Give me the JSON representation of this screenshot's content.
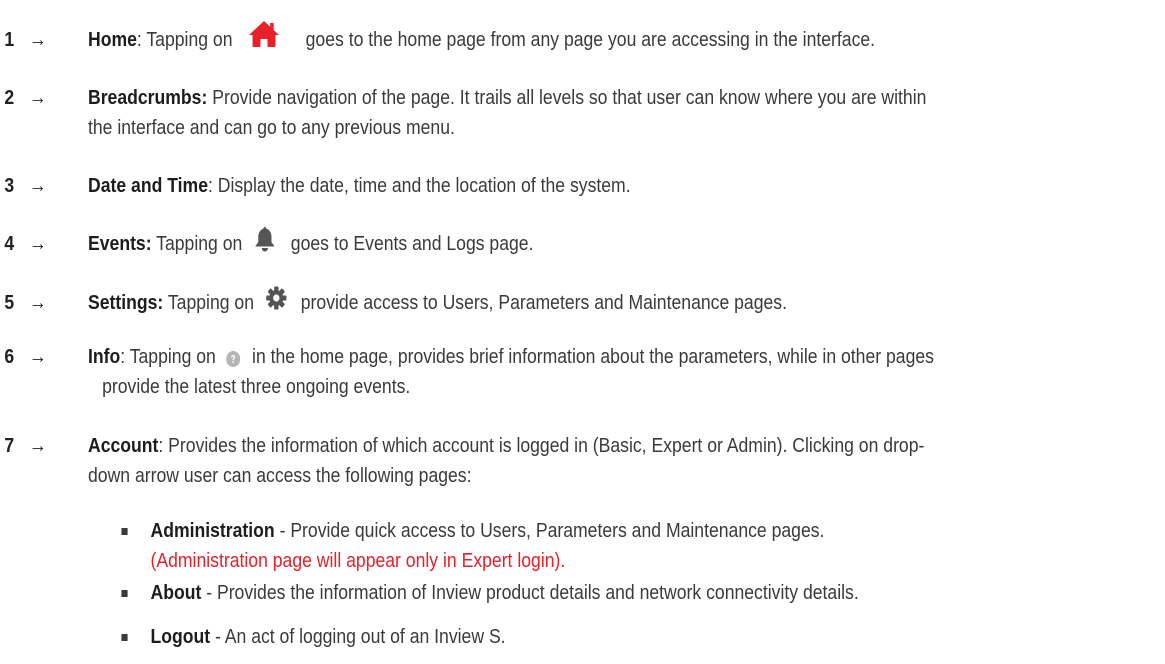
{
  "items": [
    {
      "num": "1",
      "arrow": "→",
      "term": "Home",
      "sep": ": Tapping on",
      "icon": "home-icon",
      "rest": "goes to the home page from any page you are accessing in the interface."
    },
    {
      "num": "2",
      "arrow": "→",
      "term": "Breadcrumbs:",
      "rest": "Provide navigation of the page. It trails all levels so that user can know where you are within",
      "rest2": "the interface and can go to any previous menu."
    },
    {
      "num": "3",
      "arrow": "→",
      "term": "Date and Time",
      "rest": ": Display the date, time and the location of the system."
    },
    {
      "num": "4",
      "arrow": "→",
      "term": "Events:",
      "sep": "Tapping on",
      "icon": "bell-icon",
      "rest": "goes to Events and Logs page."
    },
    {
      "num": "5",
      "arrow": "→",
      "term": "Settings:",
      "sep": "Tapping on",
      "icon": "gear-icon",
      "rest": "provide access to Users, Parameters and Maintenance pages."
    },
    {
      "num": "6",
      "arrow": "→",
      "term": "Info",
      "sep": ": Tapping on",
      "icon": "help-icon",
      "rest": "in the home page, provides brief information about the parameters, while in other pages",
      "rest2": "provide the latest three ongoing events."
    },
    {
      "num": "7",
      "arrow": "→",
      "term": "Account",
      "rest": ": Provides the information of which account is logged in (Basic, Expert or Admin). Clicking on drop-",
      "rest2": "down arrow user can access the following pages:"
    }
  ],
  "subitems": [
    {
      "term": "Administration",
      "rest": "- Provide quick access to Users, Parameters and Maintenance pages.",
      "note": "(Administration page will appear only in Expert login)."
    },
    {
      "term": "About",
      "rest": "- Provides the information of Inview product details and network connectivity details."
    },
    {
      "term": "Logout",
      "rest": "- An act of logging out of an Inview S."
    }
  ],
  "colors": {
    "text": "#3a3a3a",
    "home_icon": "#e8202a",
    "icon_gray": "#555555",
    "help_icon": "#b5b5b5",
    "warning": "#e8202a"
  }
}
